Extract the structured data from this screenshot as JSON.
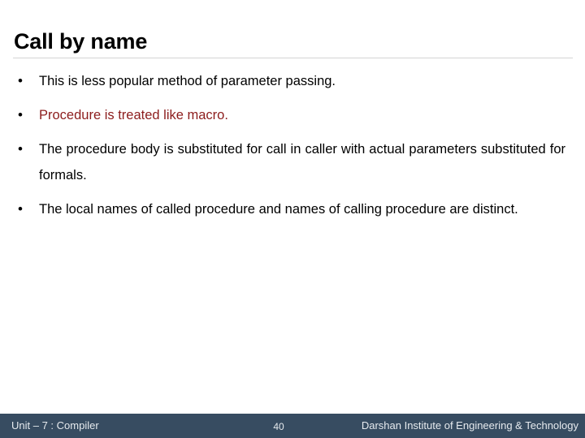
{
  "slide": {
    "title": "Call by name",
    "bullets": [
      {
        "marker": "•",
        "text": "This is less popular method of parameter passing.",
        "accent": false,
        "wraps": false
      },
      {
        "marker": "•",
        "text": "Procedure is treated like macro.",
        "accent": true,
        "wraps": false
      },
      {
        "marker": "•",
        "text": "The procedure body is substituted for call in caller with actual parameters substituted for formals.",
        "accent": false,
        "wraps": true
      },
      {
        "marker": "•",
        "text": "The local names of called procedure and names of calling procedure are distinct.",
        "accent": false,
        "wraps": true
      }
    ]
  },
  "footer": {
    "unit_label": "Unit – 7 : Compiler",
    "page_number": "40",
    "institute": "Darshan Institute of Engineering & Technology"
  },
  "colors": {
    "accent_red": "#8c1c1c",
    "footer_bg": "#374c61",
    "footer_text": "#e6eaee",
    "rule": "#d4d4d4",
    "body_text": "#000000"
  }
}
